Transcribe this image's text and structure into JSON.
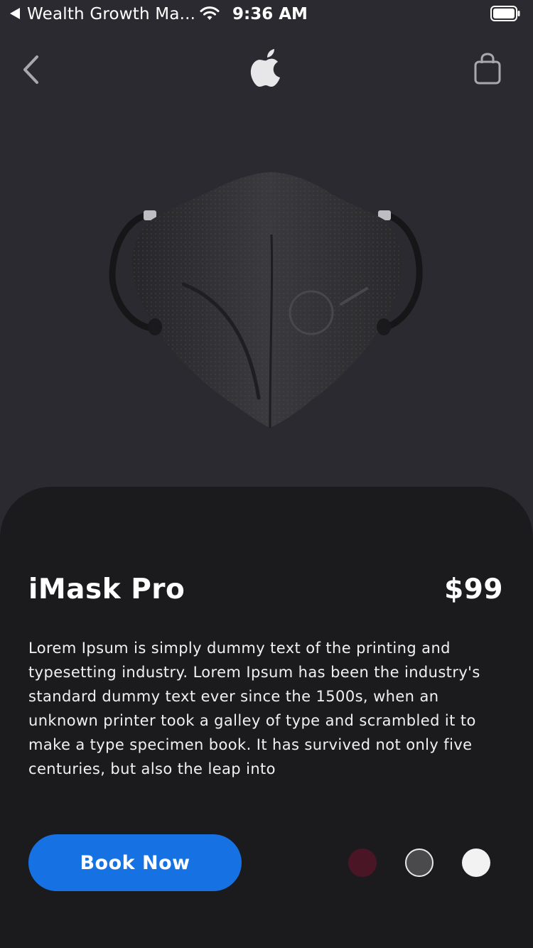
{
  "status_bar": {
    "back_app": "Wealth Growth Ma...",
    "time": "9:36 AM",
    "icons": [
      "back-arrow-icon",
      "wifi-icon",
      "battery-icon"
    ]
  },
  "nav": {
    "back_icon": "chevron-left-icon",
    "logo_icon": "apple-logo-icon",
    "cart_icon": "shopping-bag-icon"
  },
  "product": {
    "image": "black-face-mask",
    "name": "iMask Pro",
    "price": "$99",
    "description": "Lorem Ipsum is simply dummy text of the printing and typesetting industry. Lorem Ipsum has been the industry's standard dummy text ever since the 1500s, when an unknown printer took a galley of type and scrambled it to make a type specimen book. It has survived not only five centuries, but also the leap into",
    "book_label": "Book Now",
    "colors": [
      {
        "name": "maroon",
        "hex": "#4a1626"
      },
      {
        "name": "dark-gray",
        "hex": "#4a4a4c"
      },
      {
        "name": "white",
        "hex": "#f2f2f2"
      }
    ]
  },
  "theme": {
    "background": "#2b2a30",
    "card": "#1b1b1e",
    "accent": "#1672e3"
  }
}
